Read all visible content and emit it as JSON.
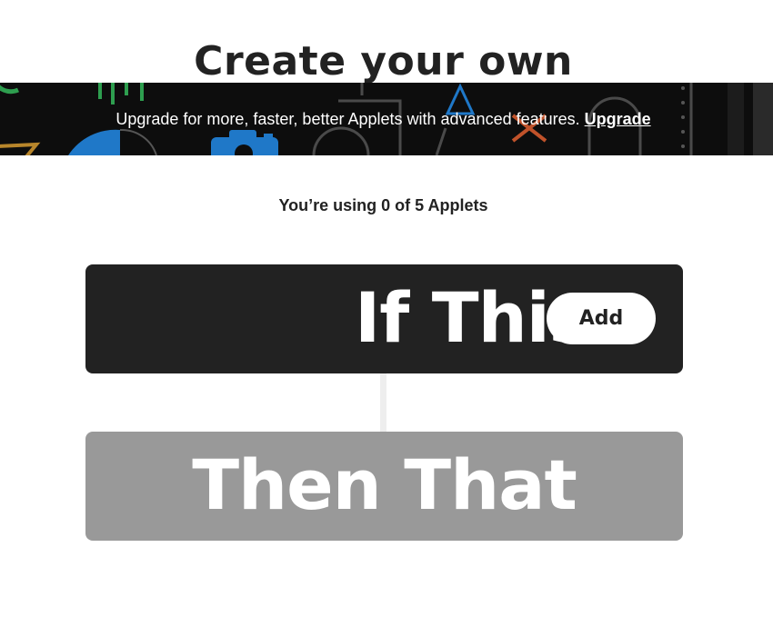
{
  "page": {
    "title": "Create your own"
  },
  "banner": {
    "message": "Upgrade for more, faster, better Applets with advanced features.",
    "link_label": "Upgrade"
  },
  "usage": {
    "text": "You’re using 0 of 5 Applets",
    "used": 0,
    "limit": 5
  },
  "builder": {
    "if_label": "If This",
    "add_label": "Add",
    "then_label": "Then That"
  },
  "colors": {
    "dark_block": "#222222",
    "disabled_block": "#999999",
    "connector": "#eeeeee",
    "banner_bg": "#0d0d0d",
    "banner_green": "#2e9e4f",
    "banner_blue": "#1f78c8",
    "banner_orange": "#c0522a",
    "banner_gold": "#b8862b"
  },
  "banner_icons": [
    "grid-lines-icon",
    "camera-icon",
    "pie-icon",
    "triangle-icon",
    "cross-icon",
    "outline-shapes-icon",
    "dots-icon"
  ]
}
